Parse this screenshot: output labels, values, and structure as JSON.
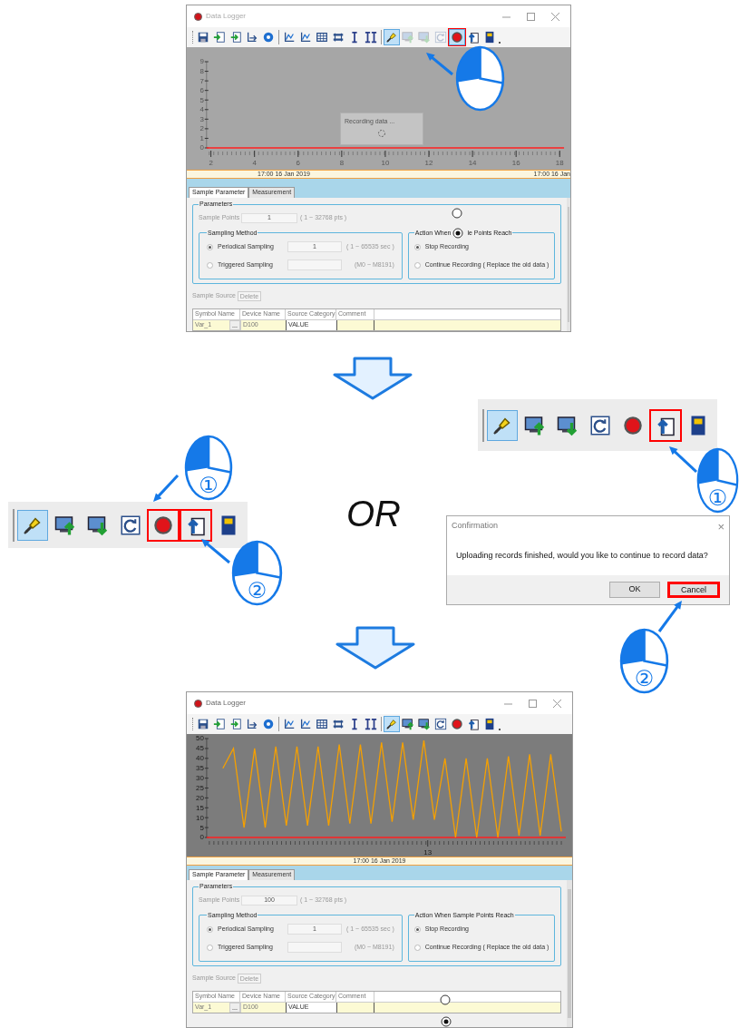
{
  "windows": [
    {
      "title": "Data Logger",
      "toolbar": [
        {
          "kind": "save",
          "selected": false,
          "disabled": false,
          "highlighted": false
        },
        {
          "kind": "import",
          "selected": false,
          "disabled": false,
          "highlighted": false
        },
        {
          "kind": "export",
          "selected": false,
          "disabled": false,
          "highlighted": false
        },
        {
          "kind": "chart-export",
          "selected": false,
          "disabled": false,
          "highlighted": false
        },
        {
          "kind": "settings",
          "selected": false,
          "disabled": false,
          "highlighted": false
        },
        {
          "kind": "separator"
        },
        {
          "kind": "axis",
          "selected": false,
          "disabled": false,
          "highlighted": false
        },
        {
          "kind": "axis",
          "selected": false,
          "disabled": false,
          "highlighted": false
        },
        {
          "kind": "grid",
          "selected": false,
          "disabled": false,
          "highlighted": false
        },
        {
          "kind": "fit",
          "selected": false,
          "disabled": false,
          "highlighted": false
        },
        {
          "kind": "cursor",
          "selected": false,
          "disabled": false,
          "highlighted": false
        },
        {
          "kind": "cursor2",
          "selected": false,
          "disabled": false,
          "highlighted": false
        },
        {
          "kind": "separator"
        },
        {
          "kind": "connect",
          "selected": true,
          "disabled": false,
          "highlighted": false
        },
        {
          "kind": "upload-pc",
          "selected": false,
          "disabled": true,
          "highlighted": false
        },
        {
          "kind": "download-pc",
          "selected": false,
          "disabled": true,
          "highlighted": false
        },
        {
          "kind": "refresh",
          "selected": false,
          "disabled": true,
          "highlighted": false
        },
        {
          "kind": "record",
          "selected": true,
          "disabled": false,
          "highlighted": true
        },
        {
          "kind": "upload",
          "selected": false,
          "disabled": false,
          "highlighted": false
        },
        {
          "kind": "sdcard",
          "selected": false,
          "disabled": false,
          "highlighted": false
        },
        {
          "kind": "overflow"
        }
      ],
      "chart": {
        "overlay": "Recording data ...",
        "chart_data": {
          "type": "line",
          "xlim": [
            1.8,
            18.2
          ],
          "ylim": [
            0,
            9
          ],
          "xticks": [
            2,
            4,
            6,
            8,
            10,
            12,
            14,
            16,
            18
          ],
          "yticks": [
            0,
            1,
            2,
            3,
            4,
            5,
            6,
            7,
            8,
            9
          ]
        },
        "time_labels": [
          "17:00 16 Jan 2019",
          "17:00 16 Jan"
        ]
      },
      "tabs": [
        {
          "label": "Sample Parameter",
          "selected": true
        },
        {
          "label": "Measurement",
          "selected": false
        }
      ],
      "parameters": {
        "title": "Parameters",
        "sample_points_label": "Sample Points",
        "sample_points": "1",
        "sample_points_range": "( 1 ~ 32768 pts )",
        "sampling_method": {
          "title": "Sampling Method",
          "options": [
            {
              "label": "Periodical Sampling",
              "selected": true,
              "value": "1",
              "range": "( 1 ~ 65535 sec )"
            },
            {
              "label": "Triggered Sampling",
              "selected": false,
              "range": "(M0 ~ M8191)"
            }
          ]
        },
        "action": {
          "title_parts": [
            "Action When",
            "le Points Reach"
          ],
          "options": [
            {
              "label": "Stop Recording",
              "selected": true
            },
            {
              "label": "Continue Recording ( Replace the old data )",
              "selected": false
            }
          ]
        }
      },
      "sample_source": {
        "label": "Sample Source",
        "delete": "Delete",
        "columns": [
          "Symbol Name",
          "Device Name",
          "Source Category",
          "Comment"
        ],
        "rows": [
          {
            "symbol": "Var_1",
            "browse": "...",
            "device": "D100",
            "category": "VALUE"
          }
        ]
      }
    },
    {
      "title": "Data Logger",
      "toolbar": [
        {
          "kind": "save",
          "selected": false,
          "disabled": false,
          "highlighted": false
        },
        {
          "kind": "import",
          "selected": false,
          "disabled": false,
          "highlighted": false
        },
        {
          "kind": "export",
          "selected": false,
          "disabled": false,
          "highlighted": false
        },
        {
          "kind": "chart-export",
          "selected": false,
          "disabled": false,
          "highlighted": false
        },
        {
          "kind": "settings",
          "selected": false,
          "disabled": false,
          "highlighted": false
        },
        {
          "kind": "separator"
        },
        {
          "kind": "axis",
          "selected": false,
          "disabled": false,
          "highlighted": false
        },
        {
          "kind": "axis",
          "selected": false,
          "disabled": false,
          "highlighted": false
        },
        {
          "kind": "grid",
          "selected": false,
          "disabled": false,
          "highlighted": false
        },
        {
          "kind": "fit",
          "selected": false,
          "disabled": false,
          "highlighted": false
        },
        {
          "kind": "cursor",
          "selected": false,
          "disabled": false,
          "highlighted": false
        },
        {
          "kind": "cursor2",
          "selected": false,
          "disabled": false,
          "highlighted": false
        },
        {
          "kind": "separator"
        },
        {
          "kind": "connect",
          "selected": true,
          "disabled": false,
          "highlighted": false
        },
        {
          "kind": "upload-pc",
          "selected": false,
          "disabled": false,
          "highlighted": false
        },
        {
          "kind": "download-pc",
          "selected": false,
          "disabled": false,
          "highlighted": false
        },
        {
          "kind": "refresh",
          "selected": false,
          "disabled": false,
          "highlighted": false
        },
        {
          "kind": "record",
          "selected": false,
          "disabled": false,
          "highlighted": false
        },
        {
          "kind": "upload",
          "selected": false,
          "disabled": false,
          "highlighted": false
        },
        {
          "kind": "sdcard",
          "selected": false,
          "disabled": false,
          "highlighted": false
        },
        {
          "kind": "overflow"
        }
      ],
      "chart": {
        "chart_data": {
          "type": "line",
          "ylim": [
            0,
            50
          ],
          "yticks": [
            0,
            5,
            10,
            15,
            20,
            25,
            30,
            35,
            40,
            45,
            50
          ],
          "annotations": [
            "13"
          ],
          "series": [
            {
              "color": "#f5a000",
              "values": [
                35,
                45,
                5,
                45,
                5,
                46,
                6,
                46,
                6,
                46,
                6,
                47,
                7,
                47,
                7,
                48,
                8,
                48,
                9,
                49,
                9,
                40,
                0,
                40,
                0,
                40,
                0,
                41,
                1,
                42,
                1,
                42,
                3
              ]
            }
          ]
        },
        "time_labels": [
          "17:00 16 Jan 2019"
        ]
      },
      "tabs": [
        {
          "label": "Sample Parameter",
          "selected": true
        },
        {
          "label": "Measurement",
          "selected": false
        }
      ],
      "parameters": {
        "title": "Parameters",
        "sample_points_label": "Sample Points",
        "sample_points": "100",
        "sample_points_range": "( 1 ~ 32768 pts )",
        "sampling_method": {
          "title": "Sampling Method",
          "options": [
            {
              "label": "Periodical Sampling",
              "selected": true,
              "value": "1",
              "range": "( 1 ~ 65535 sec )"
            },
            {
              "label": "Triggered Sampling",
              "selected": false,
              "range": "(M0 ~ M8191)"
            }
          ]
        },
        "action": {
          "title_parts": [
            "Action When Sample Points Reach"
          ],
          "options": [
            {
              "label": "Stop Recording",
              "selected": true
            },
            {
              "label": "Continue Recording ( Replace the old data )",
              "selected": false
            }
          ]
        }
      },
      "sample_source": {
        "label": "Sample Source",
        "delete": "Delete",
        "columns": [
          "Symbol Name",
          "Device Name",
          "Source Category",
          "Comment"
        ],
        "rows": [
          {
            "symbol": "Var_1",
            "browse": "...",
            "device": "D100",
            "category": "VALUE"
          }
        ]
      }
    }
  ],
  "toolbar_strips": [
    {
      "buttons": [
        {
          "kind": "connect",
          "selected": true,
          "highlighted": false
        },
        {
          "kind": "upload-pc",
          "selected": false,
          "highlighted": false
        },
        {
          "kind": "download-pc",
          "selected": false,
          "highlighted": false
        },
        {
          "kind": "refresh",
          "selected": false,
          "highlighted": false
        },
        {
          "kind": "record",
          "selected": false,
          "highlighted": true
        },
        {
          "kind": "upload",
          "selected": false,
          "highlighted": true
        },
        {
          "kind": "sdcard",
          "selected": false,
          "highlighted": false
        }
      ]
    },
    {
      "buttons": [
        {
          "kind": "connect",
          "selected": true,
          "highlighted": false
        },
        {
          "kind": "upload-pc",
          "selected": false,
          "highlighted": false
        },
        {
          "kind": "download-pc",
          "selected": false,
          "highlighted": false
        },
        {
          "kind": "refresh",
          "selected": false,
          "highlighted": false
        },
        {
          "kind": "record",
          "selected": false,
          "highlighted": false
        },
        {
          "kind": "upload",
          "selected": false,
          "highlighted": true
        },
        {
          "kind": "sdcard",
          "selected": false,
          "highlighted": false
        }
      ]
    }
  ],
  "or_label": "OR",
  "mouse_callouts": [
    {
      "step": "①"
    },
    {
      "step": "②"
    },
    {
      "step": "①"
    },
    {
      "step": "②"
    }
  ],
  "dialog": {
    "title": "Confirmation",
    "close": "×",
    "message": "Uploading records finished, would you like to continue to record data?",
    "buttons": [
      {
        "label": "OK",
        "highlighted": false
      },
      {
        "label": "Cancel",
        "highlighted": true
      }
    ]
  }
}
